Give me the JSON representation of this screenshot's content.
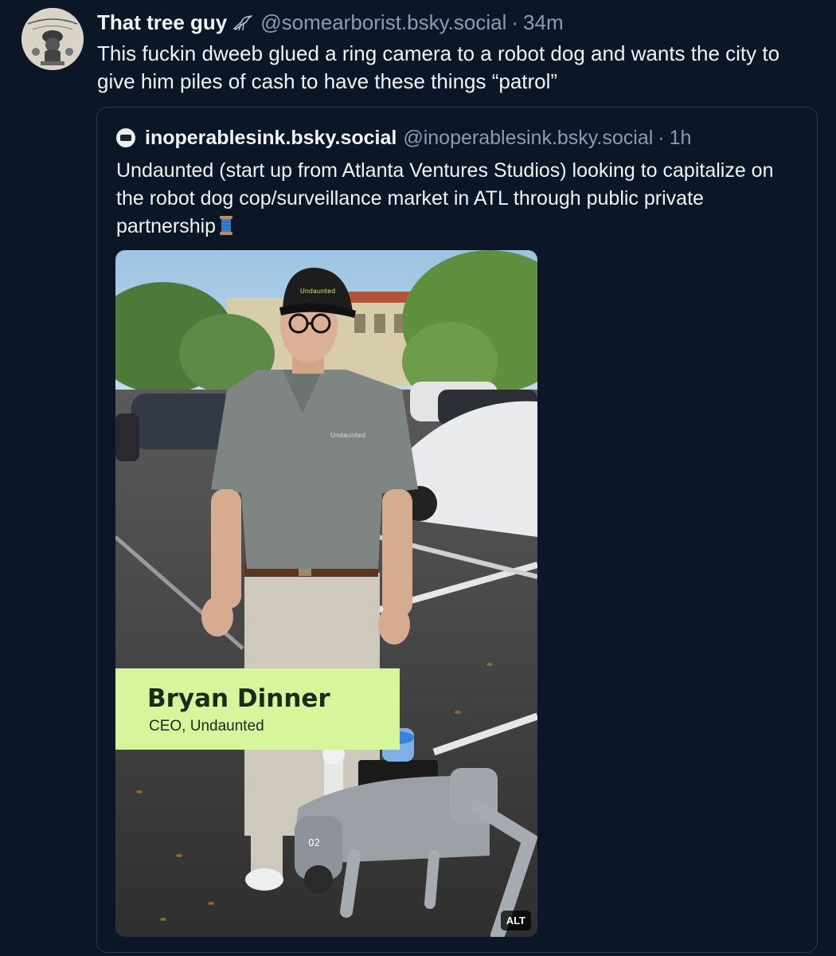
{
  "post": {
    "author": {
      "display_name": "That tree guy",
      "badge_icon": "bird-icon",
      "handle": "@somearborist.bsky.social",
      "timestamp": "34m",
      "separator": "·"
    },
    "text": "This fuckin dweeb glued a ring camera to a robot dog and wants the city to give him piles of cash to have these things “patrol”"
  },
  "quote": {
    "author": {
      "display_name": "inoperablesink.bsky.social",
      "handle": "@inoperablesink.bsky.social",
      "timestamp": "1h",
      "separator": "·"
    },
    "text": "Undaunted (start up from Atlanta Ventures Studios) looking to capitalize on the robot dog cop/surveillance market  in ATL through public private partnership",
    "text_icon": "spool-of-thread-icon",
    "media": {
      "lower_third_name": "Bryan Dinner",
      "lower_third_title": "CEO, Undaunted",
      "alt_badge": "ALT"
    }
  },
  "colors": {
    "background": "#0b1627",
    "text_primary": "#f1f3f5",
    "text_secondary": "#8c9cb0",
    "card_border": "#2c3a4f",
    "lower_third_bg": "#d7f59b"
  }
}
